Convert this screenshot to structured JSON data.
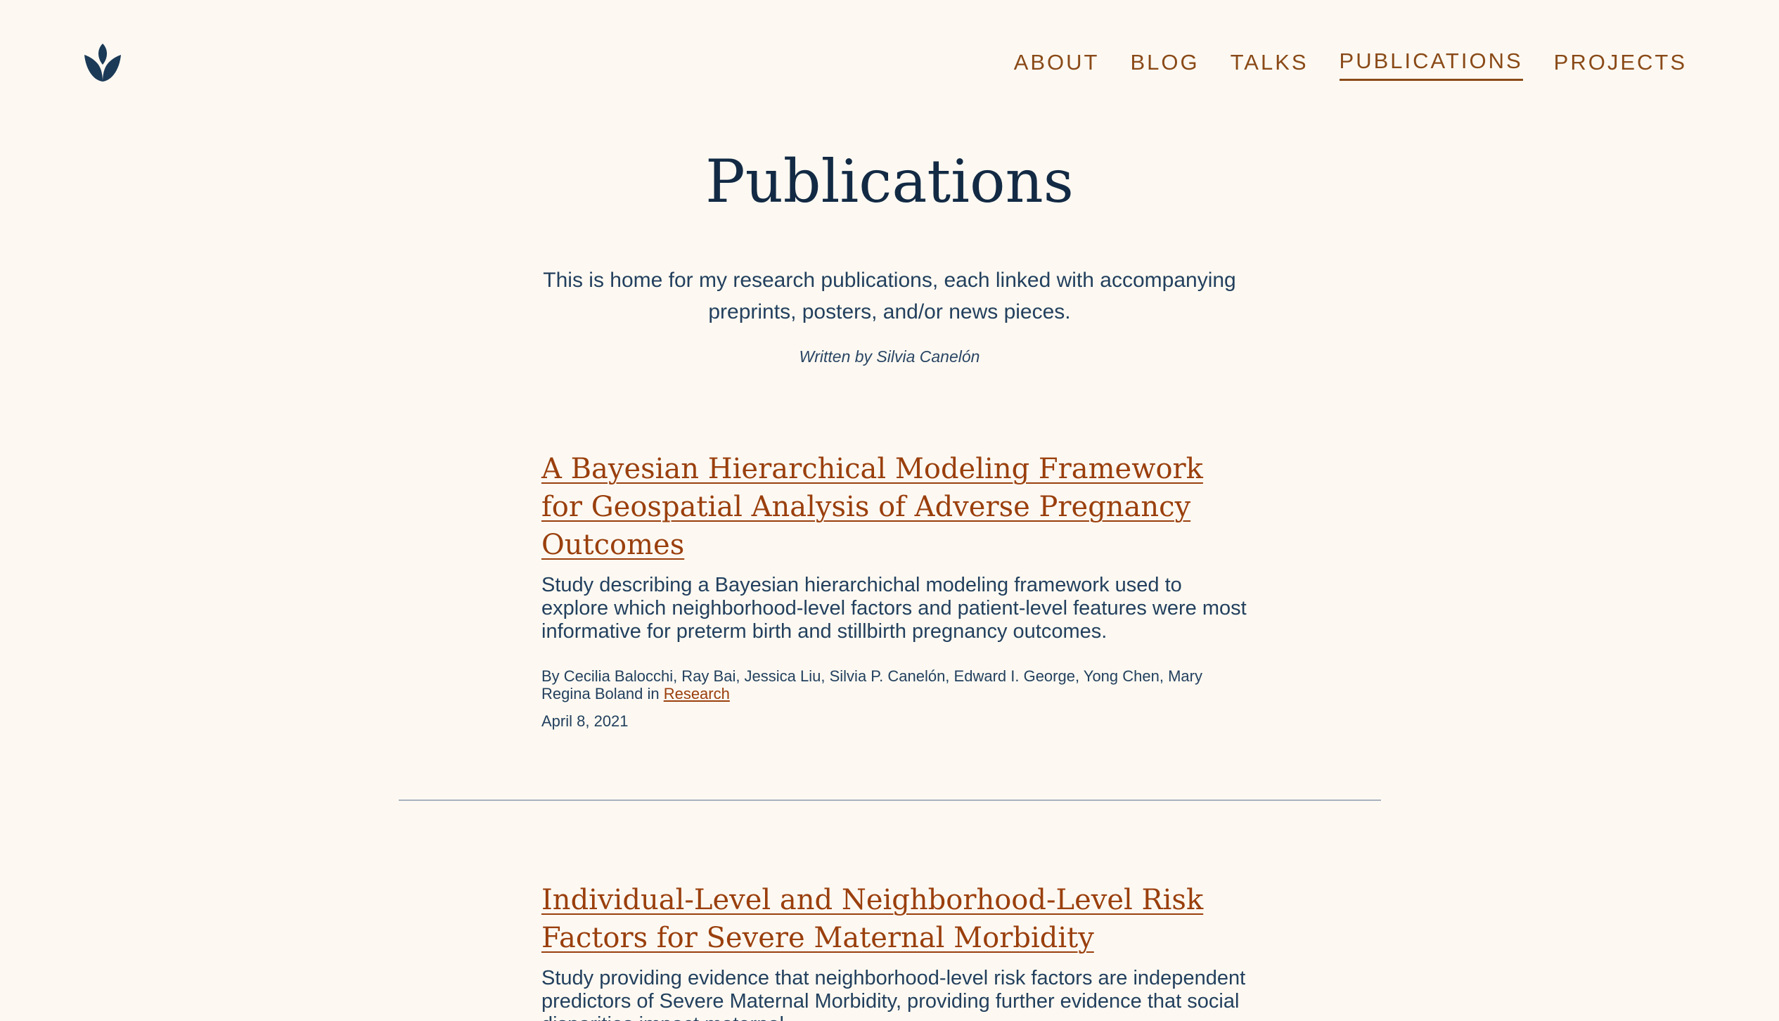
{
  "nav": {
    "items": [
      {
        "label": "ABOUT",
        "active": false
      },
      {
        "label": "BLOG",
        "active": false
      },
      {
        "label": "TALKS",
        "active": false
      },
      {
        "label": "PUBLICATIONS",
        "active": true
      },
      {
        "label": "PROJECTS",
        "active": false
      }
    ]
  },
  "logo": {
    "icon": "tulip-logo-icon"
  },
  "header": {
    "title": "Publications",
    "intro": "This is home for my research publications, each linked with accompanying preprints, posters, and/or news pieces.",
    "byline": "Written by Silvia Canelón"
  },
  "publications": [
    {
      "title": "A Bayesian Hierarchical Modeling Framework for Geospatial Analysis of Adverse Pregnancy Outcomes",
      "description": "Study describing a Bayesian hierarchichal modeling framework used to explore which neighborhood-level factors and patient-level features were most informative for preterm birth and stillbirth pregnancy outcomes.",
      "authors": "By Cecilia Balocchi, Ray Bai, Jessica Liu, Silvia P. Canelón, Edward I. George, Yong Chen, Mary Regina Boland in",
      "category": "Research",
      "date": "April 8, 2021"
    },
    {
      "title": "Individual-Level and Neighborhood-Level Risk Factors for Severe Maternal Morbidity",
      "description": "Study providing evidence that neighborhood-level risk factors are independent predictors of Severe Maternal Morbidity, providing further evidence that social disparities impact maternal",
      "authors": "",
      "category": "",
      "date": ""
    }
  ],
  "colors": {
    "background": "#fdf9f2",
    "accent": "#9a3f0d",
    "text": "#23405e",
    "title": "#132a44"
  }
}
